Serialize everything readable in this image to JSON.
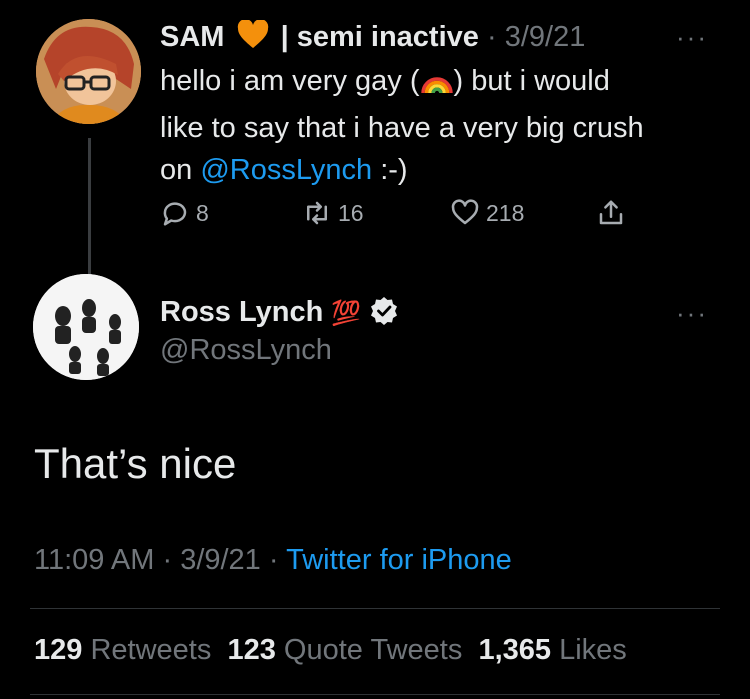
{
  "parent_tweet": {
    "display_name": "SAM",
    "name_suffix": "| semi inactive",
    "separator": "·",
    "date": "3/9/21",
    "more": "···",
    "text_line1_pre": "hello i am very gay (",
    "text_line1_post": ") but i would",
    "text_line2": "like to say that i have a very big crush",
    "text_line3_pre": "on ",
    "mention": "@RossLynch",
    "text_line3_post": " :-)",
    "actions": {
      "replies": "8",
      "retweets": "16",
      "likes": "218"
    }
  },
  "main_tweet": {
    "display_name": "Ross Lynch",
    "emoji_badge": "💯",
    "handle": "@RossLynch",
    "more": "···",
    "text": "That’s nice",
    "time": "11:09 AM",
    "date": "3/9/21",
    "separator": "·",
    "source": "Twitter for iPhone",
    "stats": {
      "retweets_count": "129",
      "retweets_label": "Retweets",
      "quotes_count": "123",
      "quotes_label": "Quote Tweets",
      "likes_count": "1,365",
      "likes_label": "Likes"
    }
  },
  "colors": {
    "background": "#000000",
    "text": "#e7e9ea",
    "muted": "#71767b",
    "link": "#1d9bf0",
    "heart_emoji": "#f4900c"
  }
}
